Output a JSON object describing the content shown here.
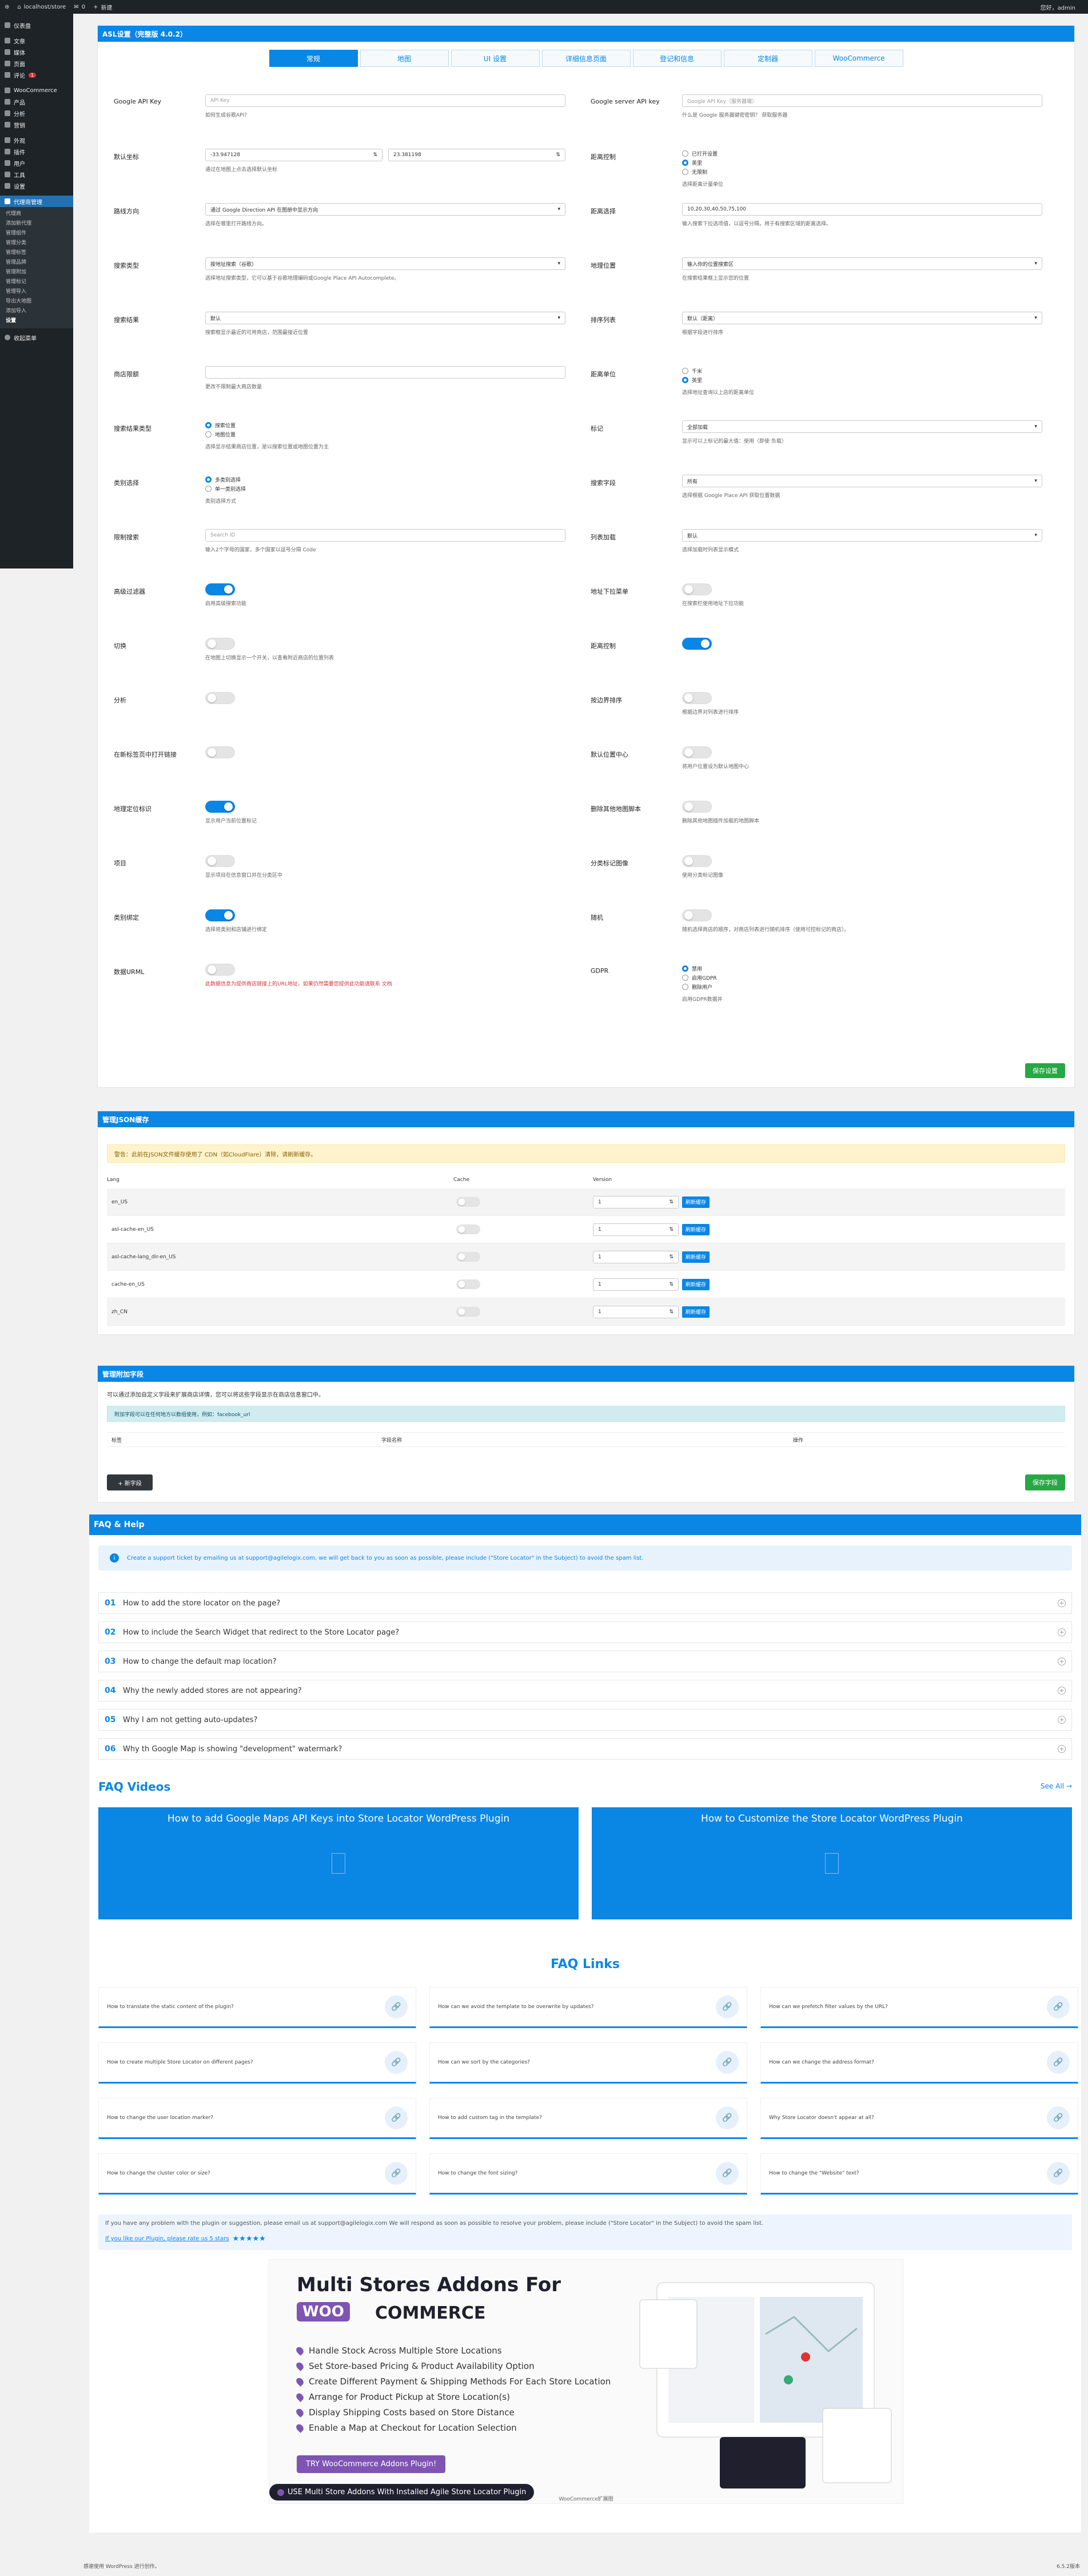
{
  "adminbar": {
    "site": "localhost/store",
    "comments": "0",
    "new": "新建",
    "greeting": "您好，admin"
  },
  "menu": {
    "items": [
      {
        "label": "仪表盘"
      },
      {
        "label": "文章"
      },
      {
        "label": "媒体"
      },
      {
        "label": "页面"
      },
      {
        "label": "评论",
        "badge": "1"
      },
      {
        "label": "WooCommerce"
      },
      {
        "label": "产品"
      },
      {
        "label": "分析"
      },
      {
        "label": "营销"
      },
      {
        "label": "外观"
      },
      {
        "label": "插件"
      },
      {
        "label": "用户"
      },
      {
        "label": "工具"
      },
      {
        "label": "设置"
      },
      {
        "label": "代理商管理"
      }
    ],
    "submenu": [
      "代理商",
      "添加新代理",
      "管理组件",
      "管理分类",
      "管理标签",
      "管理品牌",
      "管理附加",
      "管理标记",
      "管理导入",
      "导出大地图",
      "添加导入",
      "设置"
    ],
    "collapse": "收起菜单"
  },
  "settings": {
    "title": "ASL设置（完整版 4.0.2）",
    "tabs": [
      "常规",
      "地图",
      "UI 设置",
      "详细信息页面",
      "登记和信息",
      "定制器",
      "WooCommerce"
    ],
    "left": [
      {
        "label": "Google API Key",
        "type": "input",
        "placeholder": "API Key",
        "help": "如何生成谷歌API？"
      },
      {
        "label": "默认坐标",
        "type": "dual",
        "v1": "-33.947128",
        "v2": "23.381198",
        "help": "通过在地图上点击选择默认坐标"
      },
      {
        "label": "路线方向",
        "type": "select",
        "value": "通过 Google Direction API 在图册中显示方向",
        "help": "选择在哪里打开路线方向。"
      },
      {
        "label": "搜索类型",
        "type": "select",
        "value": "按地址搜索（谷歌）",
        "help": "选择地址搜索类型，它可以基于谷歌地理编码或Google Place API Autocomplete。"
      },
      {
        "label": "搜索结果",
        "type": "select",
        "value": "默认",
        "help": "搜索框显示最近的可用商店，范围最接近位置"
      },
      {
        "label": "商店限额",
        "type": "input",
        "placeholder": "",
        "help": "更改不限制最大商店数量"
      },
      {
        "label": "搜索结果类型",
        "type": "radio",
        "options": [
          "搜索位置",
          "地图位置"
        ],
        "selected": 0,
        "help": "选择显示结果商店位置，是以搜索位置或地图位置为主"
      },
      {
        "label": "类别选择",
        "type": "radio",
        "options": [
          "多类别选择",
          "单一类别选择"
        ],
        "selected": 0,
        "help": "类别选择方式"
      },
      {
        "label": "限制搜索",
        "type": "input",
        "placeholder": "Search ID",
        "help": "输入2个字母的国家，多个国家以逗号分隔 Code"
      },
      {
        "label": "高级过滤器",
        "type": "toggle",
        "on": true,
        "help": "启用高级搜索功能"
      },
      {
        "label": "切换",
        "type": "toggle",
        "on": false,
        "help": "在地图上切换显示一个开关，以查看附近商店的位置列表"
      },
      {
        "label": "分析",
        "type": "toggle",
        "on": false,
        "help": ""
      },
      {
        "label": "在新标签页中打开链接",
        "type": "toggle",
        "on": false,
        "help": ""
      },
      {
        "label": "地理定位标识",
        "type": "toggle",
        "on": true,
        "help": "显示用户当前位置标记"
      },
      {
        "label": "项目",
        "type": "toggle",
        "on": false,
        "help": "显示项目在信息窗口并在分类区中"
      },
      {
        "label": "类别绑定",
        "type": "toggle",
        "on": true,
        "help": "选择将类别和店铺进行绑定"
      },
      {
        "label": "数据URML",
        "type": "toggle",
        "on": false,
        "help": "此数据信息为提供商店链接上的URL地址、如果仍然需要您提供此功能请联系 文档",
        "warn": true
      }
    ],
    "right": [
      {
        "label": "Google server API key",
        "type": "input",
        "placeholder": "Google API Key（服务器端）",
        "help": "什么是 Google 服务器键密密钥？ 获取服务器"
      },
      {
        "label": "距离控制",
        "type": "radio",
        "options": [
          "已打开设置",
          "英里",
          "无限制"
        ],
        "selected": 1,
        "help": "选择距离计量单位"
      },
      {
        "label": "距离选择",
        "type": "input",
        "value": "10,20,30,40,50,75,100",
        "help": "输入搜索下拉选项值，以逗号分隔，用于有搜索区域的距离选择。"
      },
      {
        "label": "地理位置",
        "type": "select",
        "value": "输入你的位置搜索区",
        "help": "在搜索结果框上显示您的位置"
      },
      {
        "label": "排序列表",
        "type": "select",
        "value": "默认（距离）",
        "help": "根据字段进行排序"
      },
      {
        "label": "距离单位",
        "type": "radio",
        "options": [
          "千米",
          "英里"
        ],
        "selected": 1,
        "help": "选择地址查询以上店的距离单位"
      },
      {
        "label": "标记",
        "type": "select",
        "value": "全部加载",
        "help": "显示可以上标记的最大值：使用（即使 负载）"
      },
      {
        "label": "搜索字段",
        "type": "select",
        "value": "所有",
        "help": "选择根据 Google Place API 获取位置数据"
      },
      {
        "label": "列表加载",
        "type": "select",
        "value": "默认",
        "help": "选择加载时列表显示模式"
      },
      {
        "label": "地址下拉菜单",
        "type": "toggle",
        "on": false,
        "help": "在搜索栏使用地址下拉功能"
      },
      {
        "label": "距离控制",
        "type": "toggle",
        "on": true,
        "help": ""
      },
      {
        "label": "按边界排序",
        "type": "toggle",
        "on": false,
        "help": "根据边界对列表进行排序"
      },
      {
        "label": "默认位置中心",
        "type": "toggle",
        "on": false,
        "help": "将用户位置设为默认地图中心"
      },
      {
        "label": "删除其他地图脚本",
        "type": "toggle",
        "on": false,
        "help": "删除其他地图插件加载的地图脚本"
      },
      {
        "label": "分类标记图像",
        "type": "toggle",
        "on": false,
        "help": "使用分类标记图像"
      },
      {
        "label": "随机",
        "type": "toggle",
        "on": false,
        "help": "随机选择商店的顺序，对商店列表进行随机排序（使用可控标记的商店）。"
      },
      {
        "label": "GDPR",
        "type": "radio",
        "options": [
          "禁用",
          "启用GDPR",
          "删除用户"
        ],
        "selected": 0,
        "help": "启用GDPR数据并"
      }
    ],
    "save": "保存设置"
  },
  "cache": {
    "title": "管理JSON缓存",
    "notice": "警告：此前在JSON文件缓存使用了 CDN（如CloudFlare）清除，请刷新缓存。",
    "headers": [
      "Lang",
      "Cache",
      "Version"
    ],
    "rows": [
      {
        "lang": "en_US",
        "version": "1"
      },
      {
        "lang": "asl-cache-en_US",
        "version": "1"
      },
      {
        "lang": "asl-cache-lang_dir-en_US",
        "version": "1"
      },
      {
        "lang": "cache-en_US",
        "version": "1"
      },
      {
        "lang": "zh_CN",
        "version": "1"
      }
    ],
    "btn": "刷新缓存"
  },
  "fields": {
    "title": "管理附加字段",
    "desc": "可以通过添加自定义字段来扩展商店详情，您可以将这些字段显示在商店信息窗口中。",
    "info": "附加字段可以在任何地方以数组使用，例如：facebook_url",
    "headers": [
      "标签",
      "字段名称",
      "操作"
    ],
    "add": "+ 新字段",
    "save": "保存字段"
  },
  "faq": {
    "title": "FAQ & Help",
    "notice": "Create a support ticket by emailing us at support@agilelogix.com, we will get back to you as soon as possible, please include (\"Store Locator\" in the Subject) to avoid the spam list.",
    "items": [
      {
        "num": "01",
        "q": "How to add the store locator on the page?"
      },
      {
        "num": "02",
        "q": "How to include the Search Widget that redirect to the Store Locator page?"
      },
      {
        "num": "03",
        "q": "How to change the default map location?"
      },
      {
        "num": "04",
        "q": "Why the newly added stores are not appearing?"
      },
      {
        "num": "05",
        "q": "Why I am not getting auto-updates?"
      },
      {
        "num": "06",
        "q": "Why th Google Map is showing \"development\" watermark?"
      }
    ]
  },
  "videos": {
    "title": "FAQ Videos",
    "see_all": "See All",
    "items": [
      "How to add Google Maps API Keys into Store Locator WordPress Plugin",
      "How to Customize the Store Locator WordPress Plugin"
    ]
  },
  "links": {
    "title": "FAQ Links",
    "items": [
      "How to translate the static content of the plugin?",
      "How can we avoid the template to be overwrite by updates?",
      "How can we prefetch filter values by the URL?",
      "How to create multiple Store Locator on different pages?",
      "How can we sort by the categories?",
      "How can we change the address format?",
      "How to change the user location marker?",
      "How to add custom tag in the template?",
      "Why Store Locator doesn't appear at all?",
      "How to change the cluster color or size?",
      "How to change the font sizing?",
      "How to change the \"Website\" text?"
    ]
  },
  "support": {
    "text": "If you have any problem with the plugin or suggestion, please email us at support@agilelogix.com We will respond as soon as possible to resolve your problem, please include (\"Store Locator\" in the Subject) to avoid the spam list.",
    "rate": "If you like our Plugin, please rate us 5 stars",
    "stars": "★★★★★"
  },
  "promo": {
    "title": "Multi Stores Addons For",
    "woo": "WOO",
    "commerce": "COMMERCE",
    "features": [
      "Handle Stock Across Multiple Store Locations",
      "Set Store-based Pricing & Product Availability Option",
      "Create Different Payment & Shipping Methods For Each Store Location",
      "Arrange for Product Pickup at Store Location(s)",
      "Display Shipping Costs based on Store Distance",
      "Enable a Map at Checkout for Location Selection"
    ],
    "cta": "TRY WooCommerce Addons Plugin!",
    "cta2": "USE Multi Store Addons With Installed Agile Store Locator Plugin",
    "caption": "WooCommerce扩展图"
  },
  "footer": {
    "left": "感谢使用 WordPress 进行创作。",
    "right": "6.5.2版本"
  }
}
